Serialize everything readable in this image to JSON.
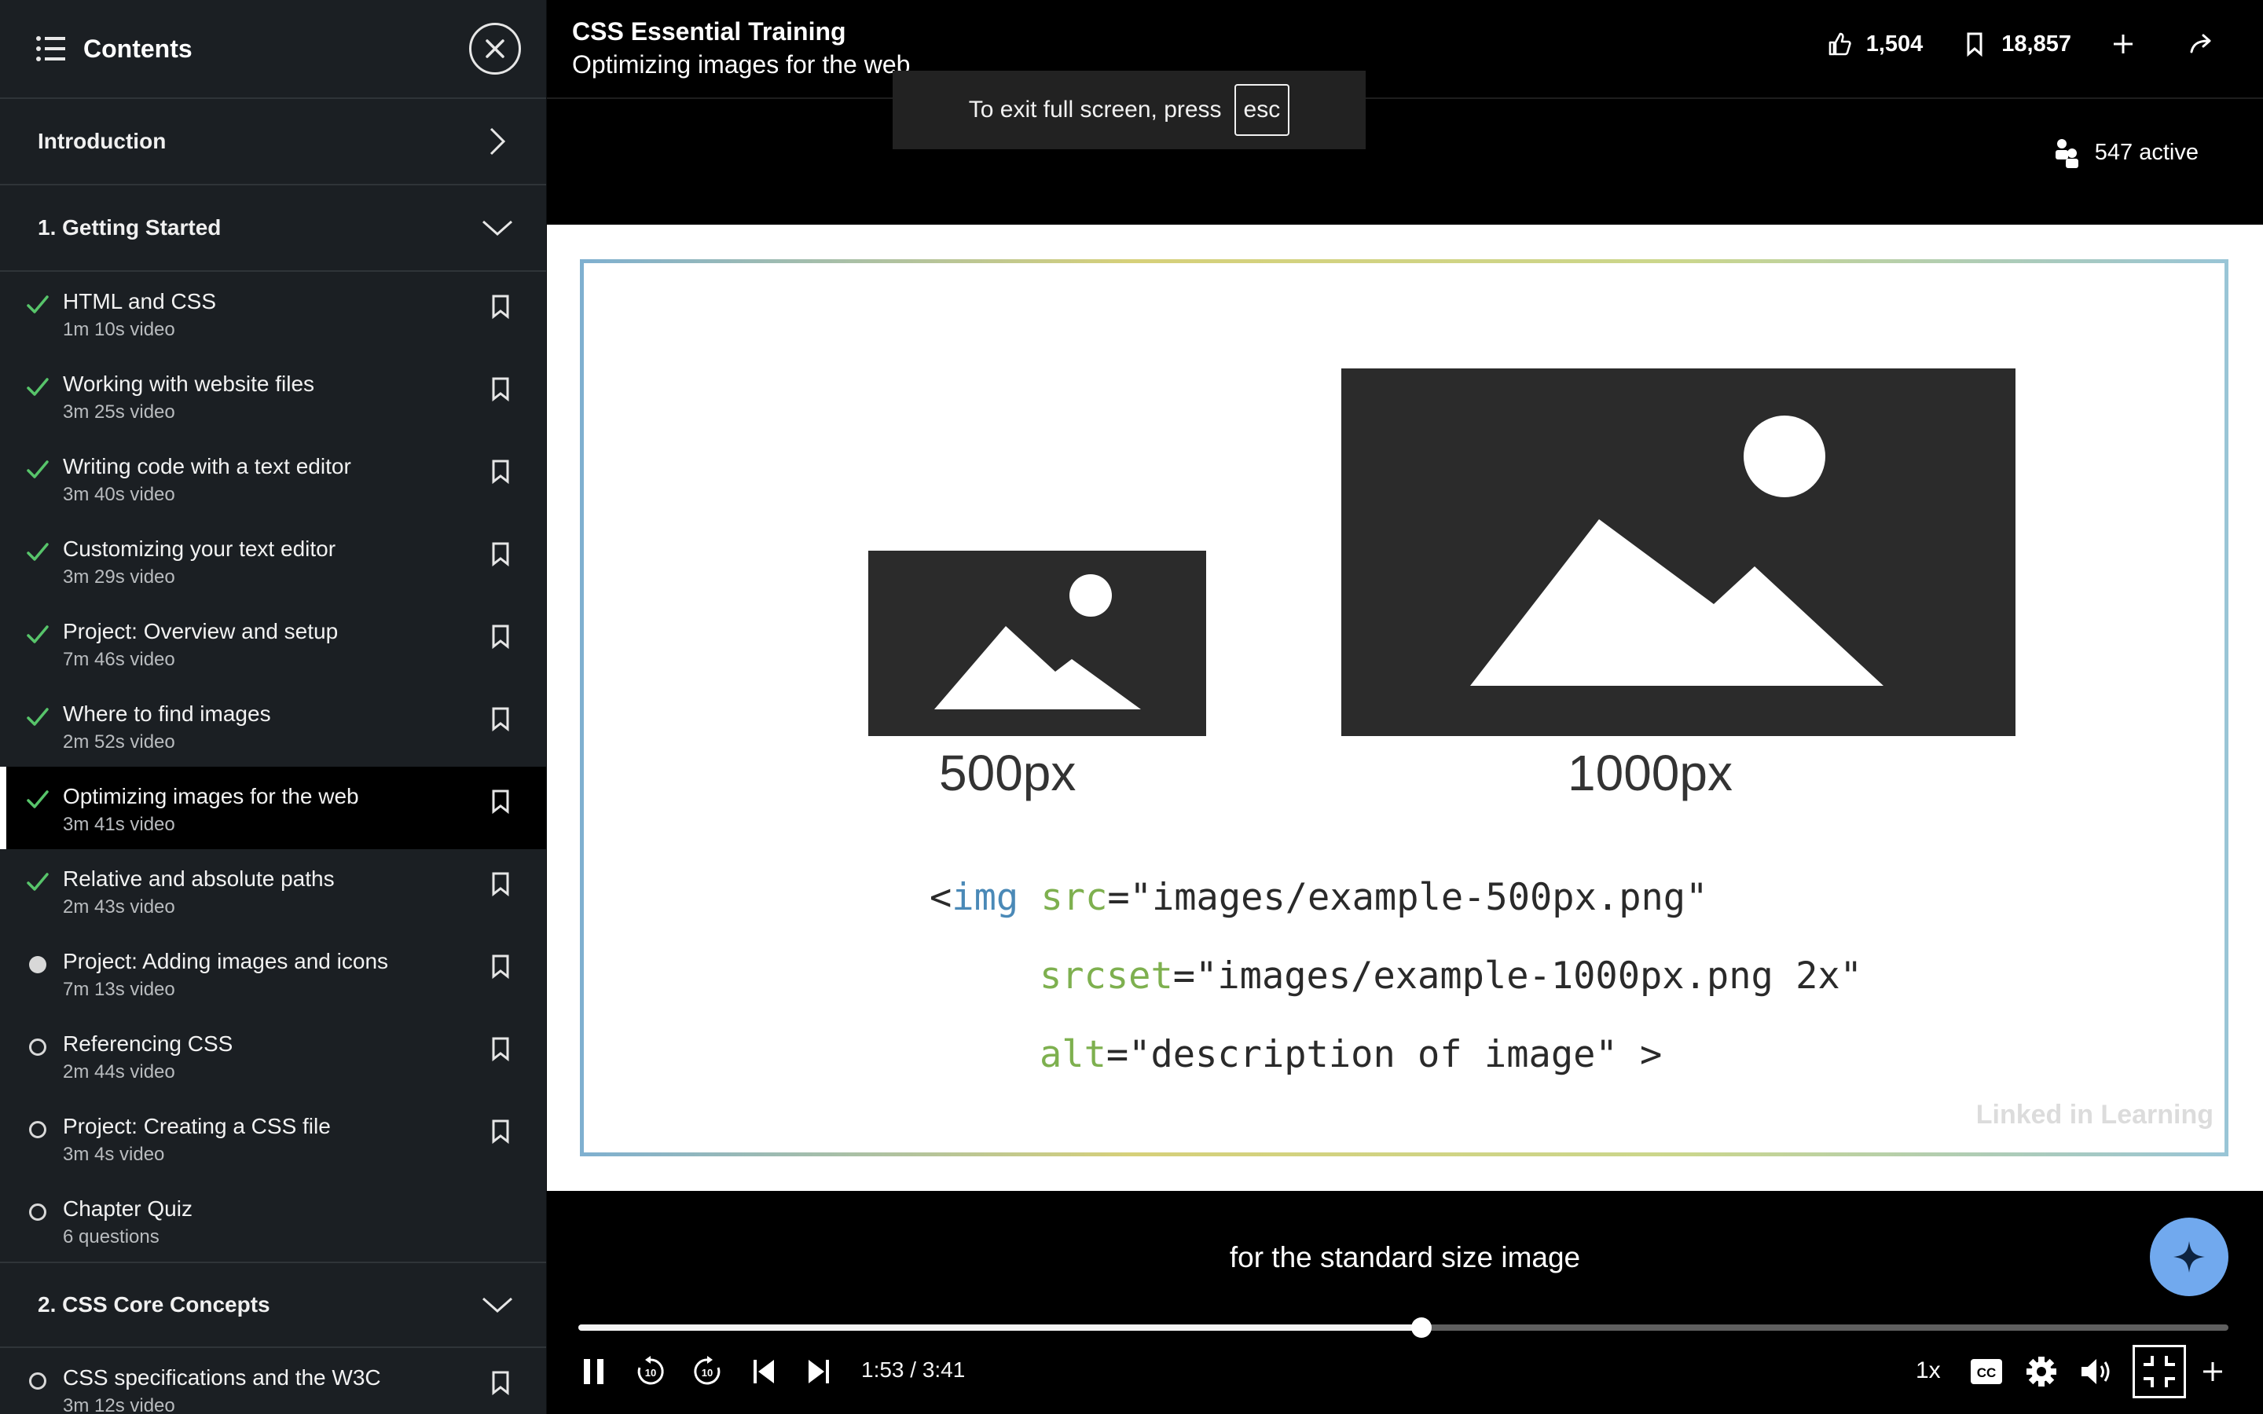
{
  "sidebar": {
    "title": "Contents",
    "sections": {
      "intro": "Introduction",
      "getting_started": "1. Getting Started",
      "core_concepts": "2. CSS Core Concepts"
    },
    "lessons": [
      {
        "title": "HTML and CSS",
        "meta": "1m 10s video",
        "status": "done"
      },
      {
        "title": "Working with website files",
        "meta": "3m 25s video",
        "status": "done"
      },
      {
        "title": "Writing code with a text editor",
        "meta": "3m 40s video",
        "status": "done"
      },
      {
        "title": "Customizing your text editor",
        "meta": "3m 29s video",
        "status": "done"
      },
      {
        "title": "Project: Overview and setup",
        "meta": "7m 46s video",
        "status": "done"
      },
      {
        "title": "Where to find images",
        "meta": "2m 52s video",
        "status": "done"
      },
      {
        "title": "Optimizing images for the web",
        "meta": "3m 41s video",
        "status": "done-active"
      },
      {
        "title": "Relative and absolute paths",
        "meta": "2m 43s video",
        "status": "done"
      },
      {
        "title": "Project: Adding images and icons",
        "meta": "7m 13s video",
        "status": "in-progress"
      },
      {
        "title": "Referencing CSS",
        "meta": "2m 44s video",
        "status": "not-started"
      },
      {
        "title": "Project: Creating a CSS file",
        "meta": "3m 4s video",
        "status": "not-started"
      },
      {
        "title": "Chapter Quiz",
        "meta": "6 questions",
        "status": "not-started"
      }
    ],
    "next_lesson": {
      "title": "CSS specifications and the W3C",
      "meta": "3m 12s video"
    }
  },
  "header": {
    "course_title": "CSS Essential Training",
    "video_title": "Optimizing images for the web",
    "likes": "1,504",
    "saves": "18,857"
  },
  "toast": {
    "text": "To exit full screen, press",
    "key": "esc"
  },
  "active_users": "547 active",
  "slide": {
    "small_caption": "500px",
    "large_caption": "1000px",
    "code_lt": "<",
    "code_tag": "img",
    "code_src_attr": "src",
    "code_src_val": "=\"images/example-500px.png\"",
    "code_srcset_attr": "srcset",
    "code_srcset_val": "=\"images/example-1000px.png 2x\"",
    "code_alt_attr": "alt",
    "code_alt_val": "=\"description of image\" >",
    "watermark": "Linked in Learning"
  },
  "player": {
    "subtitle": "for the standard size image",
    "current_time": "1:53",
    "duration": "3:41",
    "time_display": "1:53 / 3:41",
    "progress_fraction": 0.511,
    "speed": "1x"
  },
  "colors": {
    "check": "#57c46a",
    "accent": "#71a9ee"
  }
}
